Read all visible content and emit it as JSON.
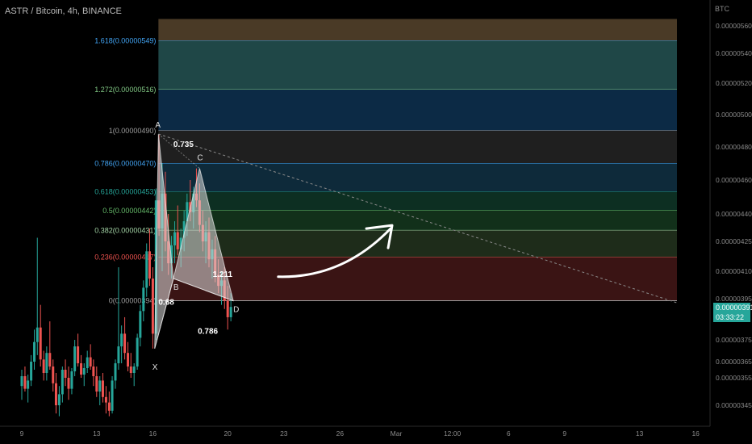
{
  "header": {
    "title": "ASTR / Bitcoin, 4h, BINANCE"
  },
  "axis": {
    "unit": "BTC"
  },
  "price_badge": {
    "price": "0.00000391",
    "countdown": "03:33:22"
  },
  "chart_data": {
    "type": "candlestick",
    "title": "ASTR / Bitcoin, 4h, BINANCE",
    "y_unit": "BTC",
    "yticks": [
      {
        "v": 345,
        "label": "0.00000345"
      },
      {
        "v": 355,
        "label": "0.00000355"
      },
      {
        "v": 365,
        "label": "0.00000365"
      },
      {
        "v": 375,
        "label": "0.00000375"
      },
      {
        "v": 395,
        "label": "0.00000395"
      },
      {
        "v": 410,
        "label": "0.00000410"
      },
      {
        "v": 425,
        "label": "0.00000425"
      },
      {
        "v": 440,
        "label": "0.00000440"
      },
      {
        "v": 460,
        "label": "0.00000460"
      },
      {
        "v": 480,
        "label": "0.00000480"
      },
      {
        "v": 500,
        "label": "0.00000500"
      },
      {
        "v": 520,
        "label": "0.00000520"
      },
      {
        "v": 540,
        "label": "0.00000540"
      },
      {
        "v": 560,
        "label": "0.00000560"
      }
    ],
    "xticks": [
      {
        "t": 0,
        "label": "9"
      },
      {
        "t": 4,
        "label": "13"
      },
      {
        "t": 7,
        "label": "16"
      },
      {
        "t": 11,
        "label": "20"
      },
      {
        "t": 14,
        "label": "23"
      },
      {
        "t": 17,
        "label": "26"
      },
      {
        "t": 20,
        "label": "Mar"
      },
      {
        "t": 23,
        "label": "12:00"
      },
      {
        "t": 26,
        "label": "6"
      },
      {
        "t": 29,
        "label": "9"
      },
      {
        "t": 33,
        "label": "13"
      },
      {
        "t": 36,
        "label": "16"
      }
    ],
    "fib_levels": [
      {
        "ratio": "1.618",
        "price": 549,
        "label": "1.618(0.00000549)",
        "color": "#42a5f5",
        "fill": "#4a3a26"
      },
      {
        "ratio": "1.272",
        "price": 516,
        "label": "1.272(0.00000516)",
        "color": "#81c784",
        "fill": "#1f4747"
      },
      {
        "ratio": "1",
        "price": 490,
        "label": "1(0.00000490)",
        "color": "#9e9e9e",
        "fill": "#0c2a45"
      },
      {
        "ratio": "0.786",
        "price": 470,
        "label": "0.786(0.00000470)",
        "color": "#42a5f5",
        "fill": "#1f1f1f"
      },
      {
        "ratio": "0.618",
        "price": 453,
        "label": "0.618(0.00000453)",
        "color": "#26a69a",
        "fill": "#0e2a3a"
      },
      {
        "ratio": "0.5",
        "price": 442,
        "label": "0.5(0.00000442)",
        "color": "#66bb6a",
        "fill": "#0d2f22"
      },
      {
        "ratio": "0.382",
        "price": 431,
        "label": "0.382(0.00000431)",
        "color": "#a5d6a7",
        "fill": "#12301a"
      },
      {
        "ratio": "0.236",
        "price": 417,
        "label": "0.236(0.00000417)",
        "color": "#ef5350",
        "fill": "#1e2c1a"
      },
      {
        "ratio": "0",
        "price": 394,
        "label": "0(0.00000394)",
        "color": "#9e9e9e",
        "fill": "#3a1414"
      }
    ],
    "fib_top": 565,
    "fib_range": {
      "t_start": 7.3,
      "t_end": 35
    },
    "pattern_points": [
      {
        "label": "X",
        "t": 7.1,
        "p": 371
      },
      {
        "label": "A",
        "t": 7.3,
        "p": 488
      },
      {
        "label": "B",
        "t": 8.1,
        "p": 406
      },
      {
        "label": "C",
        "t": 9.5,
        "p": 467
      },
      {
        "label": "D",
        "t": 11.3,
        "p": 394
      }
    ],
    "ratio_labels": [
      {
        "text": "0.735",
        "t": 8.1,
        "p": 480
      },
      {
        "text": "0.68",
        "t": 7.3,
        "p": 392
      },
      {
        "text": "0.786",
        "t": 9.4,
        "p": 378
      },
      {
        "text": "1.211",
        "t": 10.2,
        "p": 407
      }
    ],
    "trendline": {
      "from": {
        "t": 7.3,
        "p": 488
      },
      "to": {
        "t": 35,
        "p": 393
      }
    },
    "arrow": {
      "from": {
        "t": 13.7,
        "p": 407
      },
      "to": {
        "t": 19.7,
        "p": 432
      }
    },
    "last_price": 391,
    "candles": [
      {
        "t": 0.0,
        "o": 352,
        "h": 360,
        "l": 347,
        "c": 356
      },
      {
        "t": 0.17,
        "o": 356,
        "h": 362,
        "l": 350,
        "c": 351
      },
      {
        "t": 0.33,
        "o": 351,
        "h": 357,
        "l": 346,
        "c": 354
      },
      {
        "t": 0.5,
        "o": 354,
        "h": 368,
        "l": 352,
        "c": 365
      },
      {
        "t": 0.67,
        "o": 365,
        "h": 380,
        "l": 360,
        "c": 374
      },
      {
        "t": 0.83,
        "o": 374,
        "h": 427,
        "l": 368,
        "c": 381
      },
      {
        "t": 1.0,
        "o": 381,
        "h": 392,
        "l": 362,
        "c": 366
      },
      {
        "t": 1.17,
        "o": 366,
        "h": 370,
        "l": 354,
        "c": 358
      },
      {
        "t": 1.33,
        "o": 358,
        "h": 372,
        "l": 354,
        "c": 369
      },
      {
        "t": 1.5,
        "o": 369,
        "h": 384,
        "l": 360,
        "c": 362
      },
      {
        "t": 1.67,
        "o": 362,
        "h": 366,
        "l": 350,
        "c": 353
      },
      {
        "t": 1.83,
        "o": 353,
        "h": 358,
        "l": 342,
        "c": 345
      },
      {
        "t": 2.0,
        "o": 345,
        "h": 352,
        "l": 341,
        "c": 349
      },
      {
        "t": 2.17,
        "o": 349,
        "h": 362,
        "l": 346,
        "c": 360
      },
      {
        "t": 2.33,
        "o": 360,
        "h": 366,
        "l": 352,
        "c": 355
      },
      {
        "t": 2.5,
        "o": 355,
        "h": 362,
        "l": 347,
        "c": 351
      },
      {
        "t": 2.67,
        "o": 351,
        "h": 361,
        "l": 349,
        "c": 359
      },
      {
        "t": 2.83,
        "o": 359,
        "h": 375,
        "l": 356,
        "c": 372
      },
      {
        "t": 3.0,
        "o": 372,
        "h": 378,
        "l": 362,
        "c": 364
      },
      {
        "t": 3.17,
        "o": 364,
        "h": 368,
        "l": 355,
        "c": 357
      },
      {
        "t": 3.33,
        "o": 357,
        "h": 364,
        "l": 352,
        "c": 361
      },
      {
        "t": 3.5,
        "o": 361,
        "h": 370,
        "l": 358,
        "c": 367
      },
      {
        "t": 3.67,
        "o": 367,
        "h": 373,
        "l": 360,
        "c": 362
      },
      {
        "t": 3.83,
        "o": 362,
        "h": 366,
        "l": 352,
        "c": 356
      },
      {
        "t": 4.0,
        "o": 356,
        "h": 362,
        "l": 348,
        "c": 350
      },
      {
        "t": 4.17,
        "o": 350,
        "h": 356,
        "l": 345,
        "c": 354
      },
      {
        "t": 4.33,
        "o": 354,
        "h": 358,
        "l": 346,
        "c": 348
      },
      {
        "t": 4.5,
        "o": 348,
        "h": 352,
        "l": 342,
        "c": 346
      },
      {
        "t": 4.67,
        "o": 346,
        "h": 350,
        "l": 341,
        "c": 343
      },
      {
        "t": 4.83,
        "o": 343,
        "h": 356,
        "l": 342,
        "c": 354
      },
      {
        "t": 5.0,
        "o": 354,
        "h": 366,
        "l": 351,
        "c": 364
      },
      {
        "t": 5.17,
        "o": 364,
        "h": 412,
        "l": 360,
        "c": 372
      },
      {
        "t": 5.33,
        "o": 372,
        "h": 382,
        "l": 364,
        "c": 378
      },
      {
        "t": 5.5,
        "o": 378,
        "h": 386,
        "l": 366,
        "c": 369
      },
      {
        "t": 5.67,
        "o": 369,
        "h": 374,
        "l": 359,
        "c": 362
      },
      {
        "t": 5.83,
        "o": 362,
        "h": 369,
        "l": 355,
        "c": 358
      },
      {
        "t": 6.0,
        "o": 358,
        "h": 364,
        "l": 352,
        "c": 362
      },
      {
        "t": 6.17,
        "o": 362,
        "h": 378,
        "l": 360,
        "c": 376
      },
      {
        "t": 6.33,
        "o": 376,
        "h": 392,
        "l": 372,
        "c": 389
      },
      {
        "t": 6.5,
        "o": 389,
        "h": 405,
        "l": 384,
        "c": 401
      },
      {
        "t": 6.67,
        "o": 401,
        "h": 424,
        "l": 396,
        "c": 420
      },
      {
        "t": 6.83,
        "o": 420,
        "h": 432,
        "l": 402,
        "c": 406
      },
      {
        "t": 7.0,
        "o": 406,
        "h": 412,
        "l": 371,
        "c": 378
      },
      {
        "t": 7.17,
        "o": 378,
        "h": 455,
        "l": 375,
        "c": 448
      },
      {
        "t": 7.33,
        "o": 448,
        "h": 488,
        "l": 428,
        "c": 432
      },
      {
        "t": 7.5,
        "o": 432,
        "h": 470,
        "l": 410,
        "c": 452
      },
      {
        "t": 7.67,
        "o": 452,
        "h": 465,
        "l": 420,
        "c": 425
      },
      {
        "t": 7.83,
        "o": 425,
        "h": 440,
        "l": 408,
        "c": 414
      },
      {
        "t": 8.0,
        "o": 414,
        "h": 428,
        "l": 406,
        "c": 423
      },
      {
        "t": 8.17,
        "o": 423,
        "h": 436,
        "l": 414,
        "c": 430
      },
      {
        "t": 8.33,
        "o": 430,
        "h": 445,
        "l": 418,
        "c": 421
      },
      {
        "t": 8.5,
        "o": 421,
        "h": 432,
        "l": 412,
        "c": 427
      },
      {
        "t": 8.67,
        "o": 427,
        "h": 442,
        "l": 420,
        "c": 436
      },
      {
        "t": 8.83,
        "o": 436,
        "h": 452,
        "l": 428,
        "c": 447
      },
      {
        "t": 9.0,
        "o": 447,
        "h": 460,
        "l": 436,
        "c": 441
      },
      {
        "t": 9.17,
        "o": 441,
        "h": 456,
        "l": 432,
        "c": 452
      },
      {
        "t": 9.33,
        "o": 452,
        "h": 467,
        "l": 444,
        "c": 448
      },
      {
        "t": 9.5,
        "o": 448,
        "h": 458,
        "l": 430,
        "c": 434
      },
      {
        "t": 9.67,
        "o": 434,
        "h": 442,
        "l": 420,
        "c": 425
      },
      {
        "t": 9.83,
        "o": 425,
        "h": 436,
        "l": 414,
        "c": 430
      },
      {
        "t": 10.0,
        "o": 430,
        "h": 438,
        "l": 412,
        "c": 416
      },
      {
        "t": 10.17,
        "o": 416,
        "h": 426,
        "l": 406,
        "c": 421
      },
      {
        "t": 10.33,
        "o": 421,
        "h": 428,
        "l": 404,
        "c": 408
      },
      {
        "t": 10.5,
        "o": 408,
        "h": 416,
        "l": 398,
        "c": 402
      },
      {
        "t": 10.67,
        "o": 402,
        "h": 410,
        "l": 392,
        "c": 405
      },
      {
        "t": 10.83,
        "o": 405,
        "h": 412,
        "l": 390,
        "c": 394
      },
      {
        "t": 11.0,
        "o": 394,
        "h": 402,
        "l": 380,
        "c": 386
      },
      {
        "t": 11.17,
        "o": 386,
        "h": 398,
        "l": 384,
        "c": 391
      }
    ]
  }
}
